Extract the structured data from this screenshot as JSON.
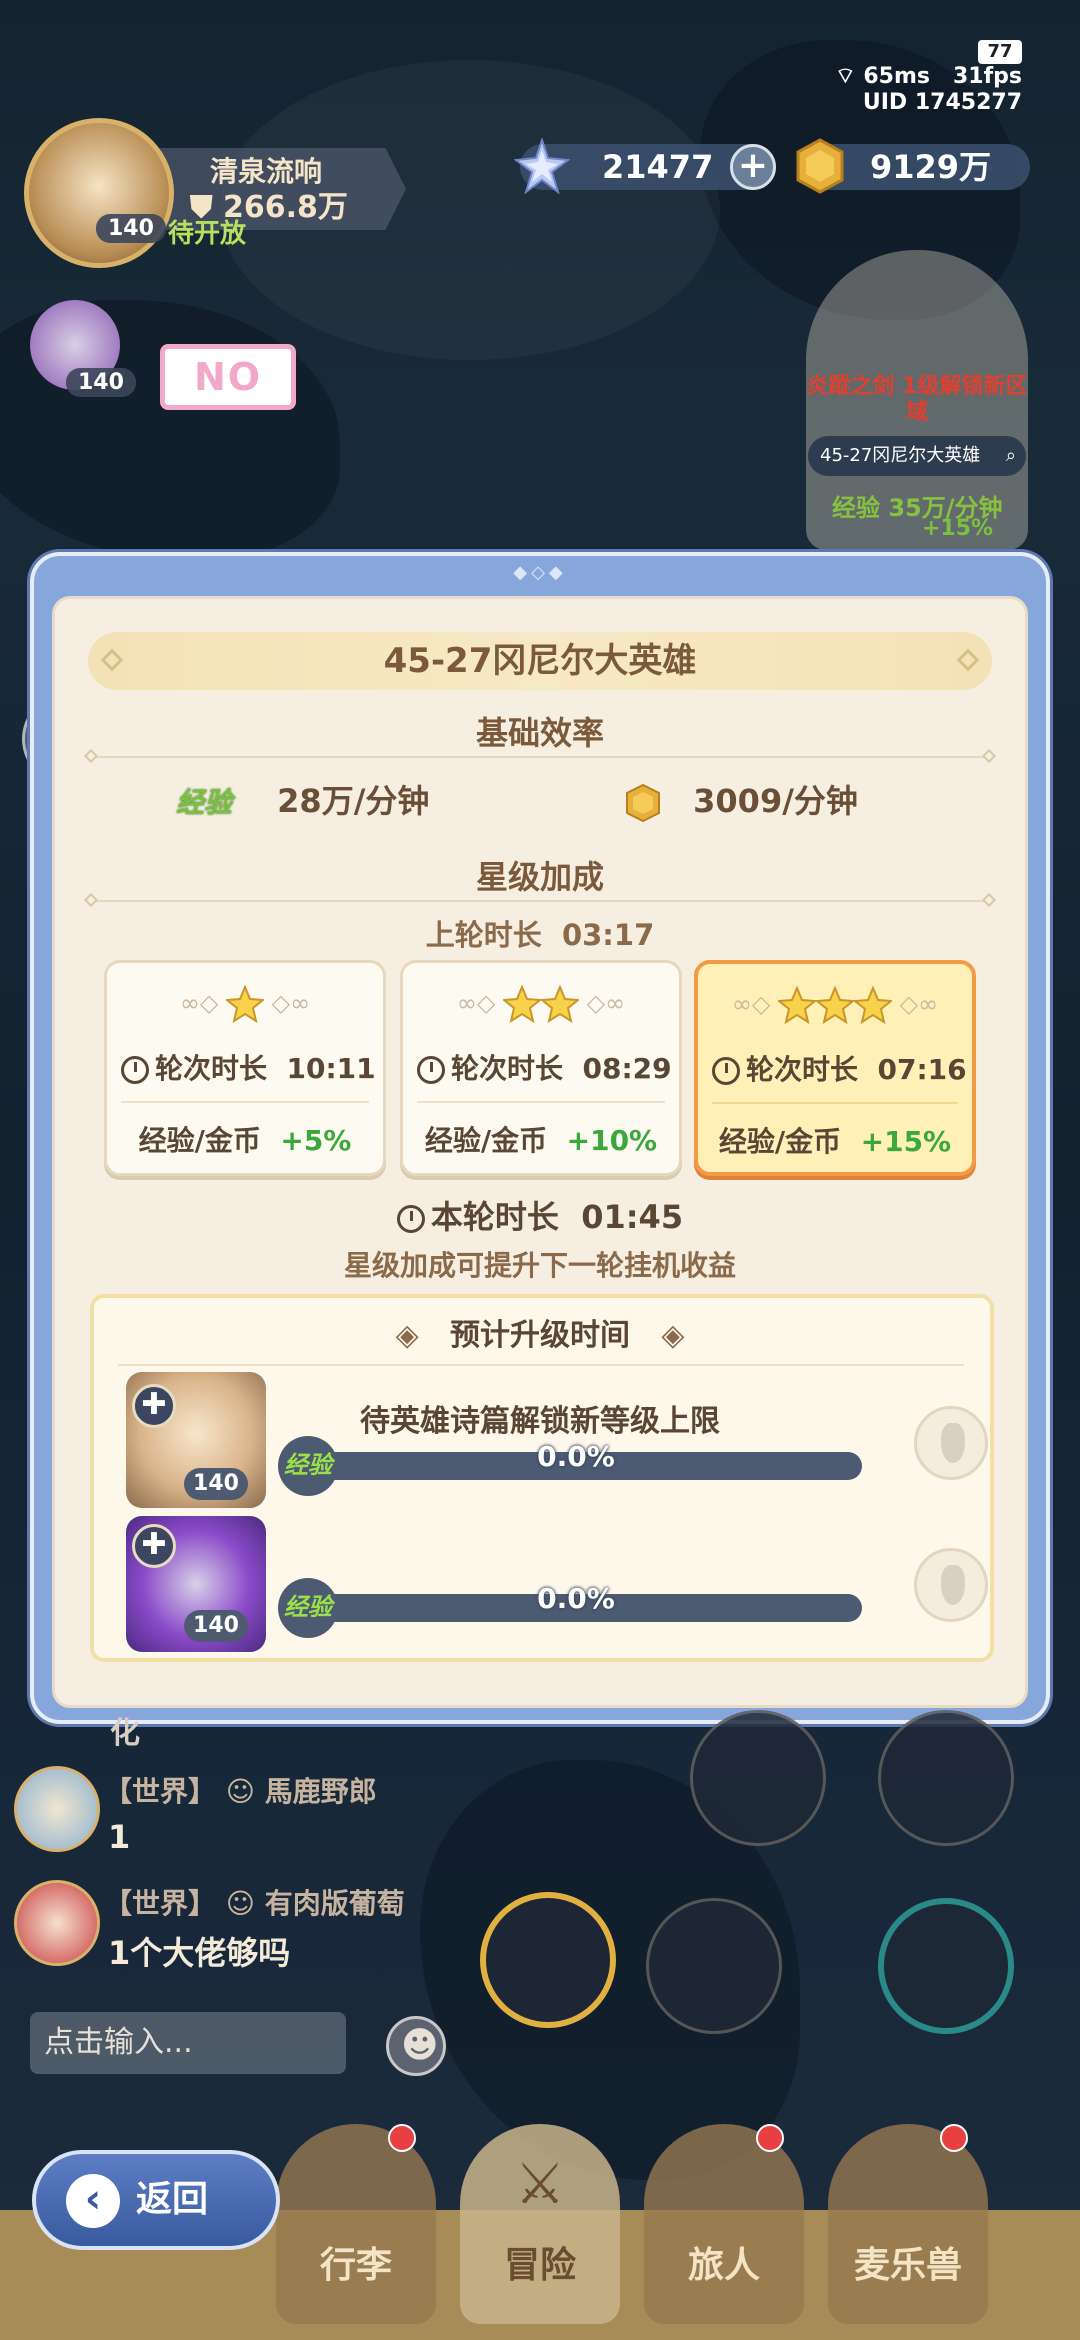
{
  "status": {
    "battery": "77",
    "ping": "65ms",
    "fps": "31fps",
    "uid": "UID 1745277"
  },
  "currency": {
    "gems": "21477",
    "gold": "9129万"
  },
  "player": {
    "name": "清泉流响",
    "power": "266.8万",
    "state": "待开放",
    "level": "140",
    "companion_level": "140"
  },
  "no_badge": "NO",
  "stage_widget": {
    "unlock_hint": "炎蹤之剑 1级解锁新区域",
    "stage": "45-27冈尼尔大英雄",
    "rate_label": "经验",
    "rate": "35万/分钟",
    "bonus": "+15%"
  },
  "modal": {
    "stage_title": "45-27冈尼尔大英雄",
    "base_efficiency": {
      "title": "基础效率",
      "exp_label": "经验",
      "exp_rate": "28万/分钟",
      "gold_rate": "3009/分钟"
    },
    "star_bonus": {
      "title": "星级加成",
      "last_round_label": "上轮时长",
      "last_round": "03:17",
      "cards": [
        {
          "stars": 1,
          "duration_label": "轮次时长",
          "duration": "10:11",
          "bonus_label": "经验/金币",
          "bonus": "+5%",
          "active": false
        },
        {
          "stars": 2,
          "duration_label": "轮次时长",
          "duration": "08:29",
          "bonus_label": "经验/金币",
          "bonus": "+10%",
          "active": false
        },
        {
          "stars": 3,
          "duration_label": "轮次时长",
          "duration": "07:16",
          "bonus_label": "经验/金币",
          "bonus": "+15%",
          "active": true
        }
      ],
      "current_round_label": "本轮时长",
      "current_round": "01:45",
      "hint": "星级加成可提升下一轮挂机收益"
    },
    "prediction": {
      "title": "预计升级时间",
      "heroes": [
        {
          "level": "140",
          "message": "待英雄诗篇解锁新等级上限",
          "exp_label": "经验",
          "progress_text": "0.0%",
          "progress": 0.0
        },
        {
          "level": "140",
          "message": "",
          "exp_label": "经验",
          "progress_text": "0.0%",
          "progress": 0.0
        }
      ]
    }
  },
  "chat": {
    "partial_char": "化",
    "messages": [
      {
        "channel": "【世界】",
        "sender": "馬鹿野郎",
        "text": "1"
      },
      {
        "channel": "【世界】",
        "sender": "有肉版葡萄",
        "text": "1个大佬够吗"
      }
    ],
    "input_placeholder": "点击输入..."
  },
  "nav": {
    "back": "返回",
    "items": [
      "行李",
      "冒险",
      "旅人",
      "麦乐兽"
    ]
  },
  "colors": {
    "accent_blue": "#86a6dc",
    "active_card_border": "#f39a44",
    "bonus_green": "#3aa83a",
    "exp_green": "#7bc040"
  }
}
